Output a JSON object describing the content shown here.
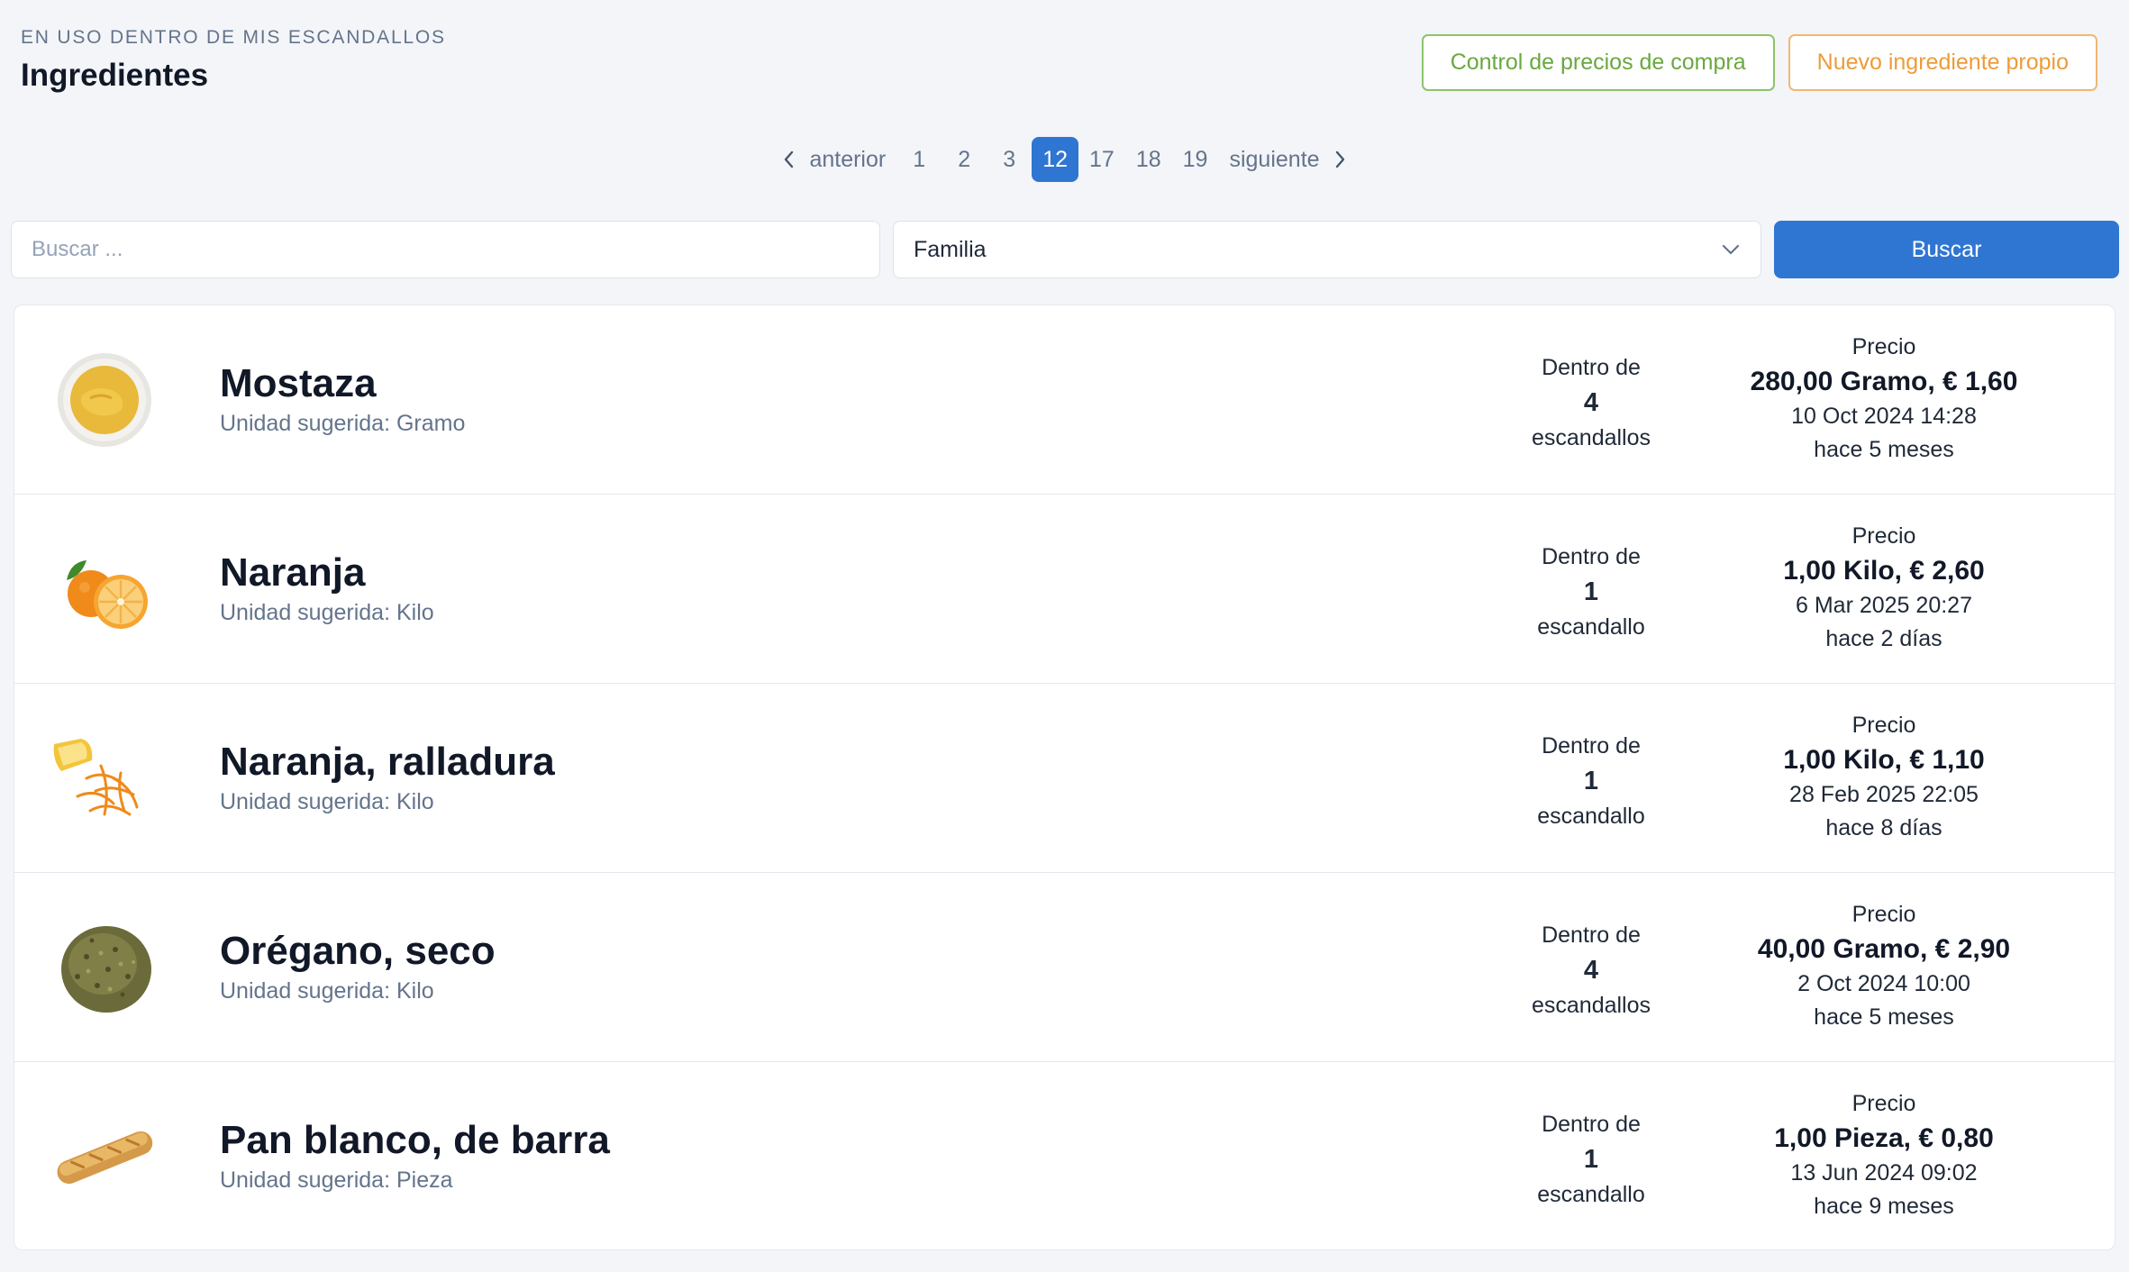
{
  "header": {
    "eyebrow": "EN USO DENTRO DE MIS ESCANDALLOS",
    "title": "Ingredientes"
  },
  "actions": {
    "price_control": "Control de precios de compra",
    "new_ingredient": "Nuevo ingrediente propio"
  },
  "pagination": {
    "prev": "anterior",
    "next": "siguiente",
    "pages": [
      "1",
      "2",
      "3",
      "12",
      "17",
      "18",
      "19"
    ],
    "current": "12"
  },
  "search": {
    "placeholder": "Buscar ...",
    "family_selected": "Familia",
    "button": "Buscar"
  },
  "labels": {
    "unit_prefix": "Unidad sugerida:",
    "inside": "Dentro de",
    "price": "Precio"
  },
  "ingredients": [
    {
      "name": "Mostaza",
      "unit": "Gramo",
      "count": "4",
      "recipes_word": "escandallos",
      "price": "280,00 Gramo, € 1,60",
      "date": "10 Oct 2024 14:28",
      "ago": "hace 5 meses",
      "icon": "mustard-icon"
    },
    {
      "name": "Naranja",
      "unit": "Kilo",
      "count": "1",
      "recipes_word": "escandallo",
      "price": "1,00 Kilo, € 2,60",
      "date": "6 Mar 2025 20:27",
      "ago": "hace 2 días",
      "icon": "orange-icon"
    },
    {
      "name": "Naranja, ralladura",
      "unit": "Kilo",
      "count": "1",
      "recipes_word": "escandallo",
      "price": "1,00 Kilo, € 1,10",
      "date": "28 Feb 2025 22:05",
      "ago": "hace 8 días",
      "icon": "orange-zest-icon"
    },
    {
      "name": "Orégano, seco",
      "unit": "Kilo",
      "count": "4",
      "recipes_word": "escandallos",
      "price": "40,00 Gramo, € 2,90",
      "date": "2 Oct 2024 10:00",
      "ago": "hace 5 meses",
      "icon": "oregano-icon"
    },
    {
      "name": "Pan blanco, de barra",
      "unit": "Pieza",
      "count": "1",
      "recipes_word": "escandallo",
      "price": "1,00 Pieza, € 0,80",
      "date": "13 Jun 2024 09:02",
      "ago": "hace 9 meses",
      "icon": "baguette-icon"
    }
  ],
  "colors": {
    "primary": "#2f76d2",
    "green_outline": "#6aa83f",
    "orange_outline": "#ec9c3c",
    "background": "#f3f5f8"
  }
}
